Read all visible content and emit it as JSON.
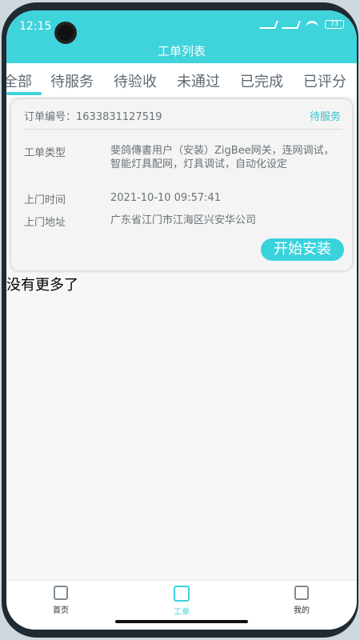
{
  "status_bar": {
    "time": "12:15",
    "battery": "73"
  },
  "header": {
    "title": "工单列表"
  },
  "tabs": [
    {
      "label": "全部"
    },
    {
      "label": "待服务"
    },
    {
      "label": "待验收"
    },
    {
      "label": "未通过"
    },
    {
      "label": "已完成"
    },
    {
      "label": "已评分"
    }
  ],
  "order": {
    "number_label": "订单编号：1633831127519",
    "status": "待服务",
    "type_label": "工单类型",
    "type_value": "斐鸽傳書用户（安装）ZigBee网关，连网调试，智能灯具配网，灯具调试，自动化设定",
    "time_label": "上门时间",
    "time_value": "2021-10-10 09:57:41",
    "address_label": "上门地址",
    "address_value": "广东省江门市江海区兴安华公司",
    "action_button": "开始安装"
  },
  "list": {
    "end_text": "没有更多了"
  },
  "tabbar": [
    {
      "label": "首页",
      "icon": "home-doc-icon"
    },
    {
      "label": "工单",
      "icon": "work-order-icon"
    },
    {
      "label": "我的",
      "icon": "profile-doc-icon"
    }
  ],
  "colors": {
    "accent": "#3fd3dc",
    "status": "#2ec4cf"
  }
}
